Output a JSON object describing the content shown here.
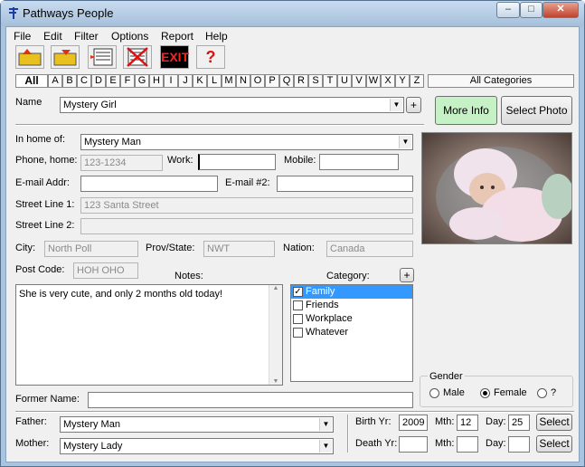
{
  "window": {
    "title": "Pathways People",
    "min": "–",
    "max": "□",
    "close": "✕"
  },
  "menu": [
    "File",
    "Edit",
    "Filter",
    "Options",
    "Report",
    "Help"
  ],
  "toolbar": {
    "exit_label": "EXIT",
    "help_label": "?"
  },
  "alpha_tabs": [
    "All",
    "A",
    "B",
    "C",
    "D",
    "E",
    "F",
    "G",
    "H",
    "I",
    "J",
    "K",
    "L",
    "M",
    "N",
    "O",
    "P",
    "Q",
    "R",
    "S",
    "T",
    "U",
    "V",
    "W",
    "X",
    "Y",
    "Z"
  ],
  "categories_button": "All Categories",
  "name": {
    "label": "Name",
    "value": "Mystery Girl",
    "plus": "+"
  },
  "buttons": {
    "more_info": "More Info",
    "select_photo": "Select Photo",
    "select": "Select"
  },
  "fields": {
    "in_home_label": "In home of:",
    "in_home_value": "Mystery Man",
    "phone_home_label": "Phone, home:",
    "phone_home_value": "123-1234",
    "work_label": "Work:",
    "work_value": "",
    "mobile_label": "Mobile:",
    "mobile_value": "",
    "email_label": "E-mail Addr:",
    "email_value": "",
    "email2_label": "E-mail #2:",
    "email2_value": "",
    "street1_label": "Street Line 1:",
    "street1_value": "123 Santa Street",
    "street2_label": "Street Line 2:",
    "street2_value": "",
    "city_label": "City:",
    "city_value": "North Poll",
    "prov_label": "Prov/State:",
    "prov_value": "NWT",
    "nation_label": "Nation:",
    "nation_value": "Canada",
    "post_label": "Post Code:",
    "post_value": "HOH OHO",
    "notes_label": "Notes:",
    "notes_value": "She is very cute, and only 2 months old today!",
    "category_label": "Category:",
    "former_label": "Former Name:",
    "former_value": "",
    "father_label": "Father:",
    "father_value": "Mystery Man",
    "mother_label": "Mother:",
    "mother_value": "Mystery Lady"
  },
  "category_items": [
    {
      "label": "Family",
      "checked": true,
      "selected": true
    },
    {
      "label": "Friends",
      "checked": false,
      "selected": false
    },
    {
      "label": "Workplace",
      "checked": false,
      "selected": false
    },
    {
      "label": "Whatever",
      "checked": false,
      "selected": false
    }
  ],
  "gender": {
    "label": "Gender",
    "options": [
      "Male",
      "Female",
      "?"
    ],
    "selected": "Female"
  },
  "birth": {
    "yr_label": "Birth Yr:",
    "yr": "2009",
    "mth_label": "Mth:",
    "mth": "12",
    "day_label": "Day:",
    "day": "25"
  },
  "death": {
    "yr_label": "Death Yr:",
    "yr": "",
    "mth_label": "Mth:",
    "mth": "",
    "day_label": "Day:",
    "day": ""
  },
  "colors": {
    "more_info_bg": "#c6f0c6",
    "selection": "#3399ff",
    "exit_red": "#d01010"
  }
}
